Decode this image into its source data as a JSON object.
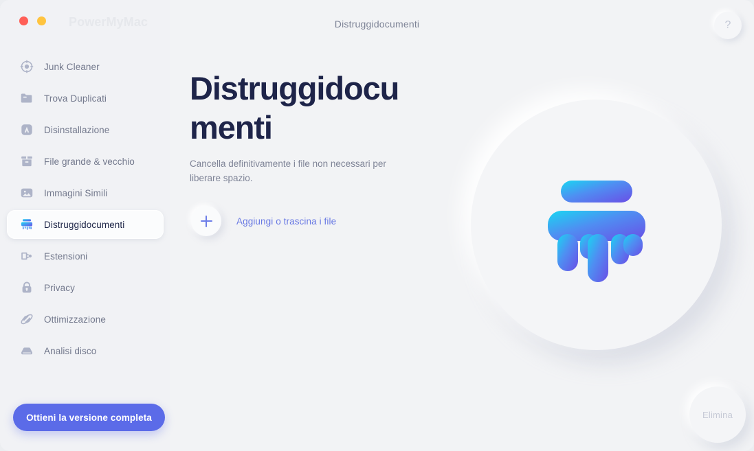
{
  "window": {
    "brand": "PowerMyMac",
    "traffic_lights": [
      "close-red",
      "minimize-yellow"
    ],
    "header_title": "Distruggidocumenti",
    "help_label": "?"
  },
  "sidebar": {
    "items": [
      {
        "label": "Junk Cleaner",
        "icon": "junk-cleaner-icon",
        "active": false
      },
      {
        "label": "Trova Duplicati",
        "icon": "folder-icon",
        "active": false
      },
      {
        "label": "Disinstallazione",
        "icon": "app-uninstall-icon",
        "active": false
      },
      {
        "label": "File grande & vecchio",
        "icon": "box-icon",
        "active": false
      },
      {
        "label": "Immagini Simili",
        "icon": "image-icon",
        "active": false
      },
      {
        "label": "Distruggidocumenti",
        "icon": "shredder-icon",
        "active": true
      },
      {
        "label": "Estensioni",
        "icon": "extension-plug-icon",
        "active": false
      },
      {
        "label": "Privacy",
        "icon": "lock-icon",
        "active": false
      },
      {
        "label": "Ottimizzazione",
        "icon": "optimization-icon",
        "active": false
      },
      {
        "label": "Analisi disco",
        "icon": "disk-icon",
        "active": false
      }
    ],
    "cta_label": "Ottieni la versione completa"
  },
  "main": {
    "heading": "Distruggidocumenti",
    "subtitle": "Cancella definitivamente i file non necessari per liberare spazio.",
    "add_label": "Aggiungi o trascina i file",
    "delete_label": "Elimina"
  },
  "colors": {
    "accent": "#5b6be8",
    "link": "#6878e3",
    "heading": "#1e2449",
    "muted": "#7f8497",
    "sidebar_bg": "#f1f2f5",
    "main_bg": "#f2f3f5",
    "traffic_red": "#ff5f57",
    "traffic_yellow": "#ffc43f",
    "gradient_start": "#19d6f2",
    "gradient_end": "#6a4ee6"
  }
}
